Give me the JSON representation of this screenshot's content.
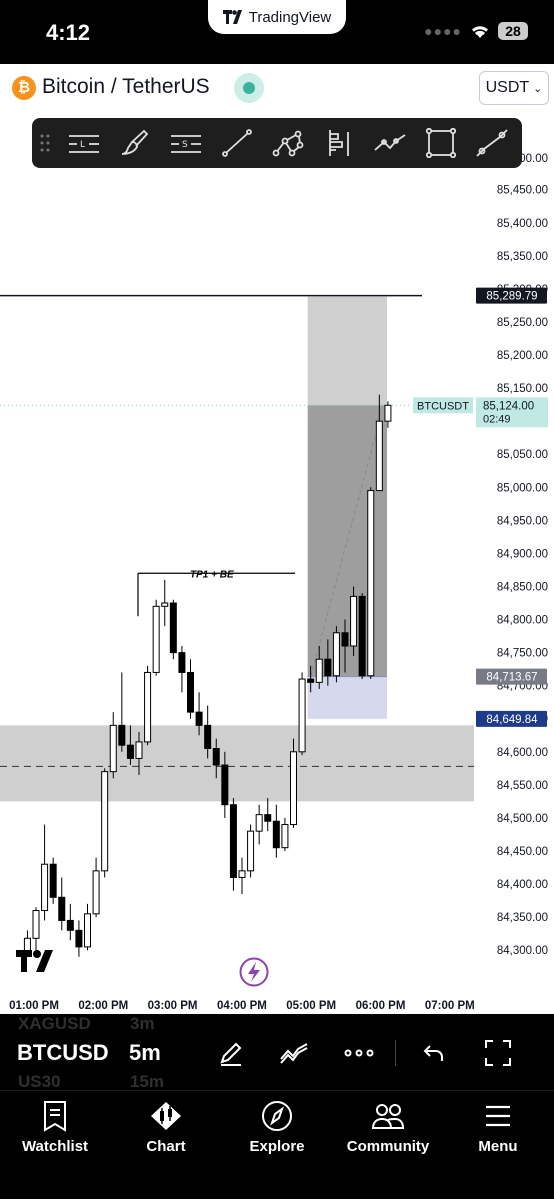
{
  "status_bar": {
    "time": "4:12",
    "app_pill": "TradingView",
    "battery": "28"
  },
  "header": {
    "symbol_title": "Bitcoin / TetherUS",
    "currency": "USDT",
    "logo_icon": "bitcoin-icon",
    "market_status": "open"
  },
  "draw_toolbar": {
    "tools": [
      "horizontal-line-icon",
      "brush-icon",
      "horizontal-ray-icon",
      "trend-line-icon",
      "pattern-icon",
      "fib-retracement-icon",
      "polyline-icon",
      "rectangle-icon",
      "measure-icon"
    ]
  },
  "chart_data": {
    "type": "candlestick",
    "symbol_label": "BTCUSDT",
    "xlabels": [
      "01:00 PM",
      "02:00 PM",
      "03:00 PM",
      "04:00 PM",
      "05:00 PM",
      "06:00 PM",
      "07:00 PM"
    ],
    "ylabels": [
      "85,450.00",
      "85,400.00",
      "85,350.00",
      "85,300.00",
      "85,250.00",
      "85,200.00",
      "85,150.00",
      "85,100.00",
      "85,050.00",
      "85,000.00",
      "84,950.00",
      "84,900.00",
      "84,850.00",
      "84,800.00",
      "84,750.00",
      "84,700.00",
      "84,650.00",
      "84,600.00",
      "84,550.00",
      "84,500.00",
      "84,450.00",
      "84,400.00",
      "84,350.00",
      "84,300.00"
    ],
    "price_tags": [
      {
        "value": "85,289.79",
        "bg": "#131722",
        "fg": "#ffffff"
      },
      {
        "value": "84,713.67",
        "bg": "#787b86",
        "fg": "#ffffff"
      },
      {
        "value": "84,649.84",
        "bg": "#1e3a8a",
        "fg": "#ffffff"
      }
    ],
    "current_price": "85,124.00",
    "countdown": "02:49",
    "annotation": "TP1 + BE",
    "candles": [
      [
        "12:55",
        84296,
        84330,
        84290,
        84318
      ],
      [
        "13:00",
        84318,
        84365,
        84300,
        84360
      ],
      [
        "13:05",
        84360,
        84490,
        84345,
        84430
      ],
      [
        "13:10",
        84430,
        84440,
        84370,
        84380
      ],
      [
        "13:15",
        84380,
        84410,
        84330,
        84345
      ],
      [
        "13:20",
        84345,
        84370,
        84315,
        84330
      ],
      [
        "13:25",
        84330,
        84345,
        84290,
        84305
      ],
      [
        "13:30",
        84305,
        84370,
        84300,
        84355
      ],
      [
        "13:35",
        84355,
        84440,
        84350,
        84420
      ],
      [
        "13:40",
        84420,
        84575,
        84410,
        84570
      ],
      [
        "13:45",
        84570,
        84660,
        84560,
        84640
      ],
      [
        "13:50",
        84640,
        84720,
        84600,
        84610
      ],
      [
        "13:55",
        84610,
        84640,
        84580,
        84590
      ],
      [
        "14:00",
        84590,
        84630,
        84565,
        84615
      ],
      [
        "14:05",
        84615,
        84730,
        84610,
        84720
      ],
      [
        "14:10",
        84720,
        84830,
        84715,
        84820
      ],
      [
        "14:15",
        84820,
        84860,
        84790,
        84825
      ],
      [
        "14:20",
        84825,
        84830,
        84740,
        84750
      ],
      [
        "14:25",
        84750,
        84760,
        84690,
        84720
      ],
      [
        "14:30",
        84720,
        84740,
        84650,
        84660
      ],
      [
        "14:35",
        84660,
        84690,
        84625,
        84640
      ],
      [
        "14:40",
        84640,
        84670,
        84590,
        84605
      ],
      [
        "14:45",
        84605,
        84620,
        84560,
        84580
      ],
      [
        "14:50",
        84580,
        84600,
        84500,
        84520
      ],
      [
        "14:55",
        84520,
        84530,
        84390,
        84410
      ],
      [
        "15:00",
        84410,
        84440,
        84385,
        84420
      ],
      [
        "15:05",
        84420,
        84490,
        84410,
        84480
      ],
      [
        "15:10",
        84480,
        84520,
        84460,
        84505
      ],
      [
        "15:15",
        84505,
        84530,
        84480,
        84495
      ],
      [
        "15:20",
        84495,
        84520,
        84440,
        84455
      ],
      [
        "15:25",
        84455,
        84500,
        84450,
        84490
      ],
      [
        "15:30",
        84490,
        84620,
        84485,
        84600
      ],
      [
        "15:35",
        84600,
        84720,
        84595,
        84710
      ],
      [
        "15:40",
        84710,
        84730,
        84690,
        84705
      ],
      [
        "15:45",
        84705,
        84760,
        84695,
        84740
      ],
      [
        "15:50",
        84740,
        84770,
        84700,
        84715
      ],
      [
        "15:55",
        84715,
        84790,
        84705,
        84780
      ],
      [
        "16:00",
        84780,
        84800,
        84720,
        84760
      ],
      [
        "16:05",
        84760,
        84850,
        84745,
        84835
      ],
      [
        "16:10",
        84835,
        84840,
        84710,
        84715
      ],
      [
        "16:15",
        84715,
        85000,
        84710,
        84995
      ],
      [
        "16:20",
        84995,
        85140,
        85030,
        85100
      ],
      [
        "16:25",
        85100,
        85130,
        85090,
        85124
      ]
    ],
    "position_zones": {
      "target_high": 85289.79,
      "profit_low": 85124.0,
      "entry": 84713.67,
      "stop": 84649.84
    },
    "demand_zone": {
      "high": 84640,
      "low": 84525,
      "mid": 84578
    }
  },
  "symbol_bar": {
    "symbol": "BTCUSD",
    "timeframe": "5m",
    "ghost_symbols": [
      "XAGUSD",
      "US30"
    ],
    "ghost_timeframes": [
      "3m",
      "15m"
    ]
  },
  "bottom_nav": {
    "items": [
      {
        "label": "Watchlist",
        "icon": "bookmark-icon"
      },
      {
        "label": "Chart",
        "icon": "candlestick-icon"
      },
      {
        "label": "Explore",
        "icon": "compass-icon"
      },
      {
        "label": "Community",
        "icon": "people-icon"
      },
      {
        "label": "Menu",
        "icon": "menu-icon"
      }
    ]
  }
}
